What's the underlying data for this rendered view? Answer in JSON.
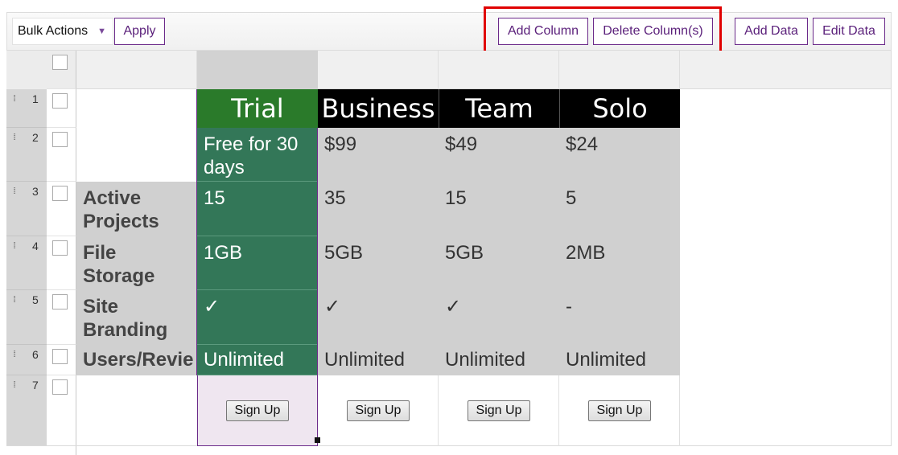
{
  "toolbar": {
    "bulk_actions": "Bulk Actions",
    "apply": "Apply",
    "add_column": "Add Column",
    "delete_columns": "Delete Column(s)",
    "add_data": "Add Data",
    "edit_data": "Edit Data"
  },
  "rows": [
    "1",
    "2",
    "3",
    "4",
    "5",
    "6",
    "7"
  ],
  "plans": [
    {
      "name": "Trial",
      "price": "Free for 30 days",
      "projects": "15",
      "storage": "1GB",
      "branding": "✓",
      "users": "Unlimited",
      "cta": "Sign Up"
    },
    {
      "name": "Business",
      "price": "$99",
      "projects": "35",
      "storage": "5GB",
      "branding": "✓",
      "users": "Unlimited",
      "cta": "Sign Up"
    },
    {
      "name": "Team",
      "price": "$49",
      "projects": "15",
      "storage": "5GB",
      "branding": "✓",
      "users": "Unlimited",
      "cta": "Sign Up"
    },
    {
      "name": "Solo",
      "price": "$24",
      "projects": "5",
      "storage": "2MB",
      "branding": "-",
      "users": "Unlimited",
      "cta": "Sign Up"
    }
  ],
  "labels": {
    "projects": "Active Projects",
    "storage": "File Storage",
    "branding": "Site Branding",
    "users": "Users/Revie"
  },
  "colors": {
    "trial_header": "#2a7a2a",
    "trial_body": "#337758",
    "other_header": "#000000",
    "body_gray": "#d0d0d0",
    "accent_purple": "#5a1f7a",
    "highlight_red": "#e00000"
  }
}
